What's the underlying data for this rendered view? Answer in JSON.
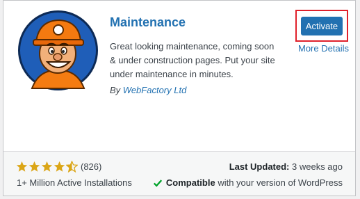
{
  "plugin": {
    "name": "Maintenance",
    "description": "Great looking maintenance, coming soon & under construction pages. Put your site under maintenance in minutes.",
    "author_prefix": "By",
    "author": "WebFactory Ltd",
    "activate_label": "Activate",
    "more_details_label": "More Details",
    "icon": "construction-worker-mascot-icon"
  },
  "footer": {
    "rating_stars": 4.5,
    "rating_max": 5,
    "rating_count": "(826)",
    "installs": "1+ Million Active Installations",
    "last_updated_label": "Last Updated:",
    "last_updated_value": "3 weeks ago",
    "compatible_label": "Compatible",
    "compatible_rest": "with your version of WordPress"
  },
  "colors": {
    "link": "#2271b1",
    "button": "#2271b1",
    "star": "#dba617",
    "check": "#00a32a",
    "highlight_border": "#e0202a"
  }
}
